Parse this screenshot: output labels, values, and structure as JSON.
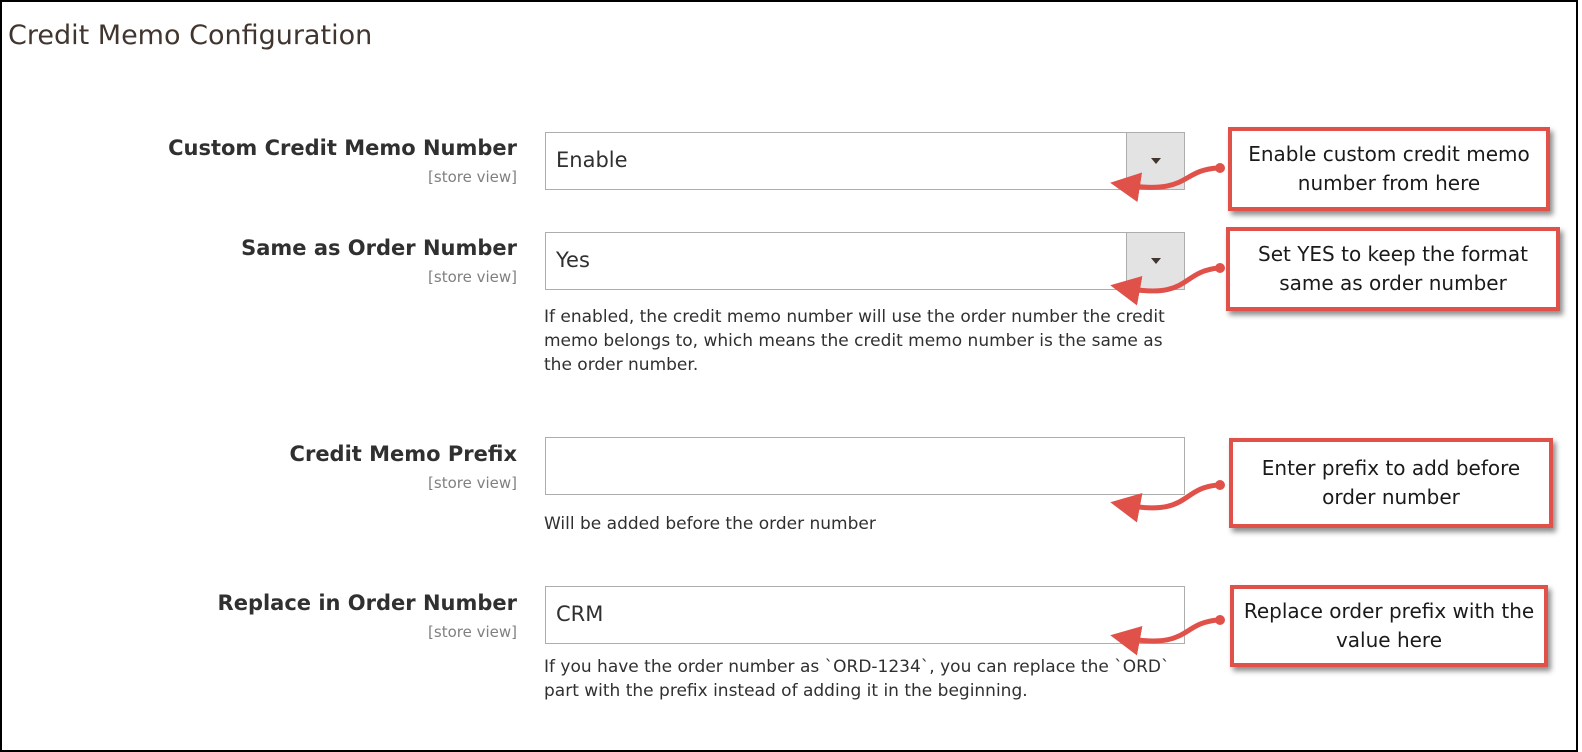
{
  "section": {
    "title": "Credit Memo Configuration"
  },
  "fields": [
    {
      "label": "Custom Credit Memo Number",
      "scope": "[store view]",
      "value": "Enable",
      "type": "select"
    },
    {
      "label": "Same as Order Number",
      "scope": "[store view]",
      "value": "Yes",
      "type": "select",
      "note": "If enabled, the credit memo number will use the order number the credit memo belongs to, which means the credit memo number is the same as the order number."
    },
    {
      "label": "Credit Memo Prefix",
      "scope": "[store view]",
      "value": "",
      "type": "text",
      "note": "Will be added before the order number"
    },
    {
      "label": "Replace in Order Number",
      "scope": "[store view]",
      "value": "CRM",
      "type": "text",
      "note": "If you have the order number as `ORD-1234`, you can replace the `ORD` part with the prefix instead of adding it in the beginning."
    }
  ],
  "callouts": [
    {
      "text": "Enable custom credit memo number from here"
    },
    {
      "text": "Set YES to keep the format same as order number"
    },
    {
      "text": "Enter prefix to add before order number"
    },
    {
      "text": "Replace order prefix with the value here"
    }
  ],
  "colors": {
    "callout_border": "#e0514a",
    "arrow": "#e0514a",
    "select_button": "#e3e3e3"
  },
  "icons": {
    "select_toggle": "caret-down-icon",
    "annotation_arrow": "curved-arrow-icon"
  }
}
